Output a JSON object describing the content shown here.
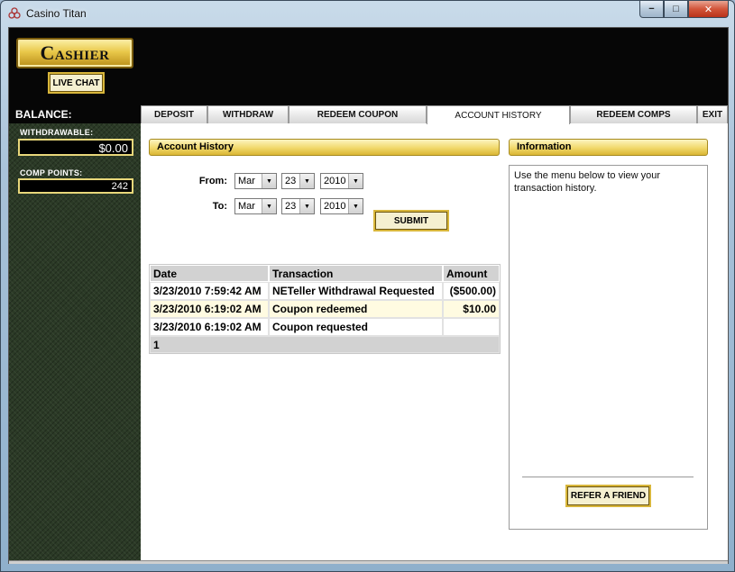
{
  "window": {
    "title": "Casino Titan",
    "buttons": {
      "minimize": "−",
      "maximize": "□",
      "close": "✕"
    }
  },
  "header": {
    "logo_text": "Cashier",
    "live_chat": "LIVE CHAT"
  },
  "sidebar": {
    "balance_title": "BALANCE:",
    "withdrawable_label": "WITHDRAWABLE:",
    "withdrawable_value": "$0.00",
    "comp_points_label": "COMP POINTS:",
    "comp_points_value": "242"
  },
  "tabs": [
    {
      "label": "DEPOSIT",
      "active": false
    },
    {
      "label": "WITHDRAW",
      "active": false
    },
    {
      "label": "REDEEM COUPON",
      "active": false
    },
    {
      "label": "ACCOUNT HISTORY",
      "active": true
    },
    {
      "label": "REDEEM COMPS",
      "active": false
    },
    {
      "label": "EXIT",
      "active": false
    }
  ],
  "history": {
    "title": "Account History",
    "from_label": "From:",
    "to_label": "To:",
    "from": {
      "month": "Mar",
      "day": "23",
      "year": "2010"
    },
    "to": {
      "month": "Mar",
      "day": "23",
      "year": "2010"
    },
    "submit": "SUBMIT",
    "columns": [
      "Date",
      "Transaction",
      "Amount"
    ],
    "rows": [
      {
        "date": "3/23/2010 7:59:42 AM",
        "transaction": "NETeller Withdrawal Requested",
        "amount": "($500.00)"
      },
      {
        "date": "3/23/2010 6:19:02 AM",
        "transaction": "Coupon redeemed",
        "amount": "$10.00"
      },
      {
        "date": "3/23/2010 6:19:02 AM",
        "transaction": "Coupon requested",
        "amount": ""
      }
    ],
    "page": "1"
  },
  "info": {
    "title": "Information",
    "text": "Use the menu below to view your transaction history.",
    "refer_button": "REFER A FRIEND"
  },
  "colors": {
    "gold": "#e9c84a",
    "header_bg": "#060606",
    "sidebar_bg": "#2b3a26",
    "row_alt": "#fffbe1"
  }
}
